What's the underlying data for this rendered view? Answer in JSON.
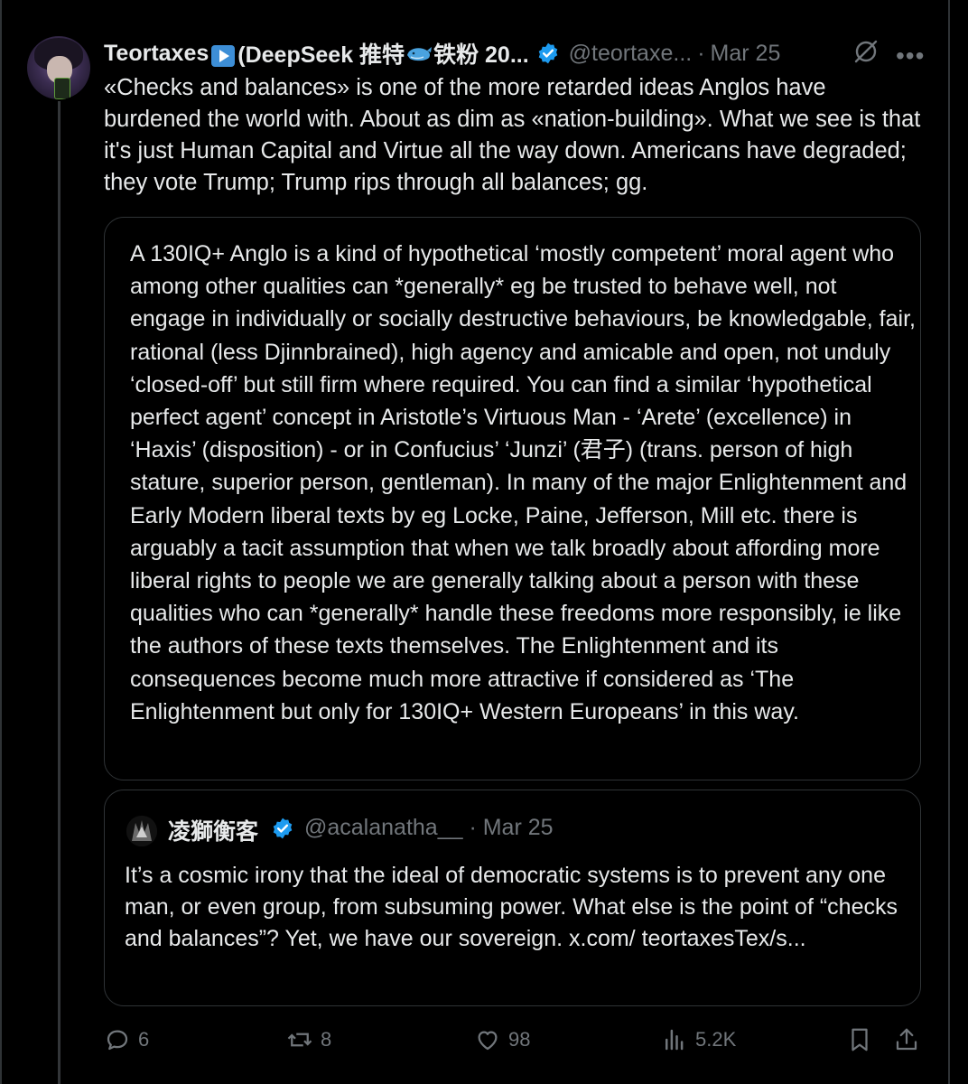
{
  "tweet": {
    "author_name_a": "Teortaxes",
    "author_name_b": " (DeepSeek 推特",
    "author_name_c": "铁粉 20...",
    "handle": "@teortaxe...",
    "separator": "·",
    "date": "Mar 25",
    "text": "«Checks and balances» is one of the more retarded ideas Anglos have burdened the world with. About as dim as «nation-building». What we see is that it's just Human Capital and Virtue all the way down. Americans have degraded; they vote Trump; Trump rips through all balances; gg."
  },
  "quoted_excerpt": {
    "text": "A 130IQ+ Anglo is a kind of hypothetical ‘mostly competent’ moral agent who among other qualities can *generally* eg be trusted to behave well, not engage in individually or socially destructive behaviours, be knowledgable, fair, rational (less Djinnbrained), high agency and amicable and open, not unduly ‘closed-off’ but still firm where required. You can find a similar ‘hypothetical perfect agent’ concept in Aristotle’s Virtuous Man - ‘Arete’ (excellence) in ‘Haxis’ (disposition) - or in Confucius’ ‘Junzi’ (君子) (trans. person of high stature, superior person, gentleman). In many of the major Enlightenment and Early Modern liberal texts by eg Locke, Paine, Jefferson, Mill etc. there is arguably a tacit assumption that when we talk broadly about affording more liberal rights to people we are generally talking about a person with these qualities who can *generally* handle these freedoms more responsibly, ie like the authors of these texts themselves. The Enlightenment and its consequences become much more attractive if considered as ‘The Enlightenment but only for 130IQ+ Western Europeans’ in this way."
  },
  "quoted_tweet": {
    "author_name": "凌獅衡客",
    "handle_date": "@acalanatha__ · Mar 25",
    "text": "It’s a cosmic irony that the ideal of democratic systems is to prevent any one man, or even group, from subsuming power. What else is the point of “checks and balances”? Yet, we have our sovereign. x.com/ teortaxesTex/s..."
  },
  "actions": {
    "replies": "6",
    "reposts": "8",
    "likes": "98",
    "views": "5.2K"
  },
  "colors": {
    "background": "#000000",
    "text": "#e7e9ea",
    "muted": "#71767b",
    "border": "#2f3336",
    "verified": "#1d9bf0"
  },
  "icons": [
    "play-badge-icon",
    "whale-emoji-icon",
    "verified-badge-icon",
    "grok-icon",
    "more-icon",
    "reply-icon",
    "repost-icon",
    "like-icon",
    "views-icon",
    "bookmark-icon",
    "share-icon"
  ]
}
